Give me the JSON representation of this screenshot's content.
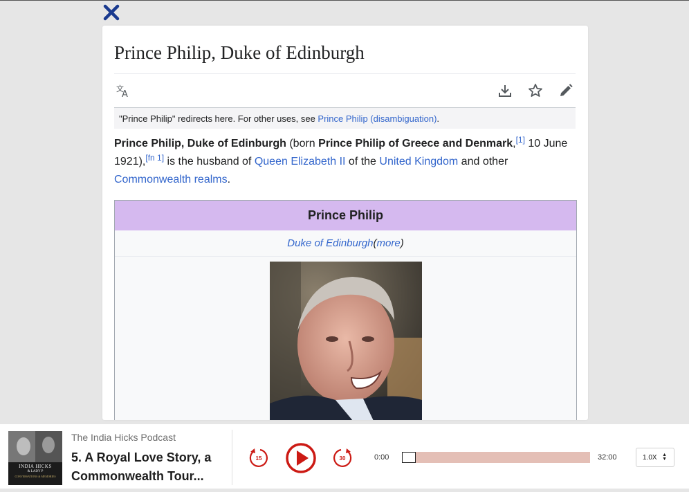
{
  "colors": {
    "close": "#1a3a8f",
    "link": "#3366cc",
    "infobox_header": "#d5b9ef",
    "player_accent": "#cc1a14",
    "progress_fill": "#e4bfb6"
  },
  "article": {
    "title": "Prince Philip, Duke of Edinburgh",
    "tools": [
      "translate-icon",
      "download-icon",
      "star-icon",
      "edit-icon"
    ],
    "hatnote": {
      "text": "\"Prince Philip\" redirects here. For other uses, see ",
      "link": "Prince Philip (disambiguation)",
      "end": "."
    },
    "lead": {
      "bold1": "Prince Philip, Duke of Edinburgh",
      "t1": " (born ",
      "bold2": "Prince Philip of Greece and Denmark",
      "t2": ",",
      "ref1": "[1]",
      "t3": " 10 June 1921),",
      "ref2": "[fn 1]",
      "t4": " is the husband of ",
      "link1": "Queen Elizabeth II",
      "t5": " of the ",
      "link2": "United Kingdom",
      "t6": " and other ",
      "link3": "Commonwealth realms",
      "t7": "."
    },
    "infobox": {
      "header": "Prince Philip",
      "subtitle_link": "Duke of Edinburgh",
      "paren_open": " (",
      "more_link": "more",
      "paren_close": ")"
    }
  },
  "player": {
    "podcast_name": "The India Hicks Podcast",
    "episode_title": "5. A Royal Love Story, a Commonwealth Tour...",
    "cover": {
      "line1": "INDIA HICKS",
      "line2": "& LADY P",
      "line3": "CONVERSATIONS & MEMORIES"
    },
    "rewind_seconds": "15",
    "forward_seconds": "30",
    "current_time": "0:00",
    "duration": "32:00",
    "progress": 0,
    "speed": "1.0X"
  }
}
